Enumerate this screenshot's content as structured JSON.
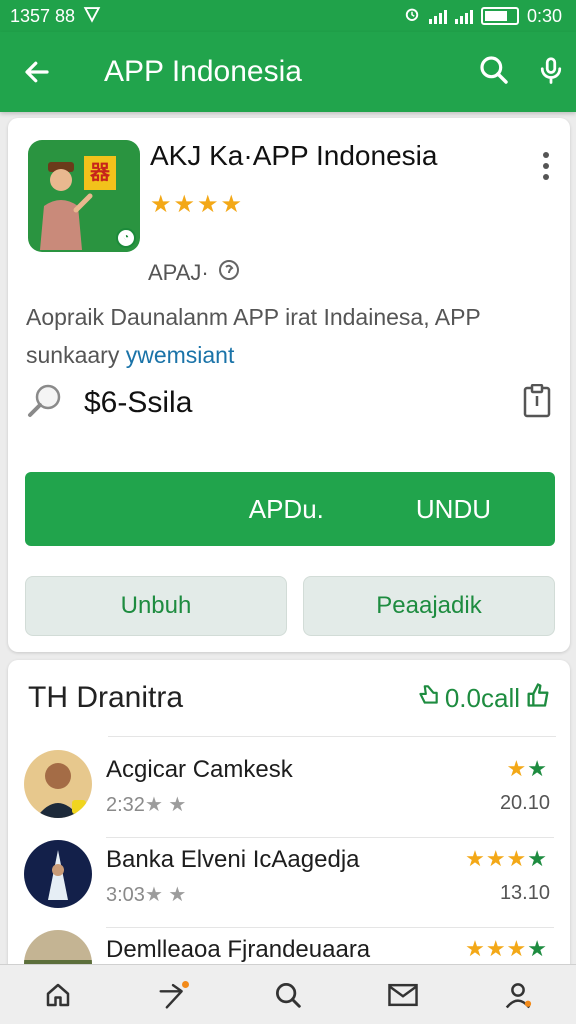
{
  "status_bar": {
    "time_left": "1357 88",
    "time_right": "0:30"
  },
  "app_bar": {
    "title": "APP Indonesia",
    "back_icon": "arrow-left-icon",
    "search_icon": "search-icon",
    "mic_icon": "mic-icon"
  },
  "app": {
    "name": "AKJ Ka·APP Indonesia",
    "stars": "★★★★",
    "developer": "APAJ·",
    "description_line1": "Aopraik Daunalanm APP irat Indainesa, APP",
    "description_line2_plain": "sunkaary",
    "description_line2_link": "ywemsiant",
    "price": "$6-Ssila",
    "install_left": "APDu.",
    "install_right": "UNDU",
    "button_left": "Unbuh",
    "button_right": "Peaajadik",
    "icon_sign": "器"
  },
  "reviews": {
    "title": "TH Dranitra",
    "count_label": "0.0call",
    "items": [
      {
        "name": "Acgicar Camkesk",
        "meta": "2:32",
        "meta_stars": "★ ★",
        "stars": "★",
        "stars_green": "★",
        "date": "20.10"
      },
      {
        "name": "Banka Elveni IcAagedja",
        "meta": "3:03",
        "meta_stars": "★ ★",
        "stars": "★★★",
        "stars_green": "★",
        "date": "13.10"
      },
      {
        "name": "Demlleaoa Fjrandeuaara",
        "meta": "",
        "meta_stars": "",
        "stars": "★★★",
        "stars_green": "★",
        "date": ""
      }
    ]
  },
  "colors": {
    "brand": "#21a44c",
    "star": "#f3a817",
    "link": "#1a73a8"
  },
  "bottom_nav": [
    "home-icon",
    "arrow-icon",
    "search-icon",
    "mail-icon",
    "profile-icon"
  ]
}
